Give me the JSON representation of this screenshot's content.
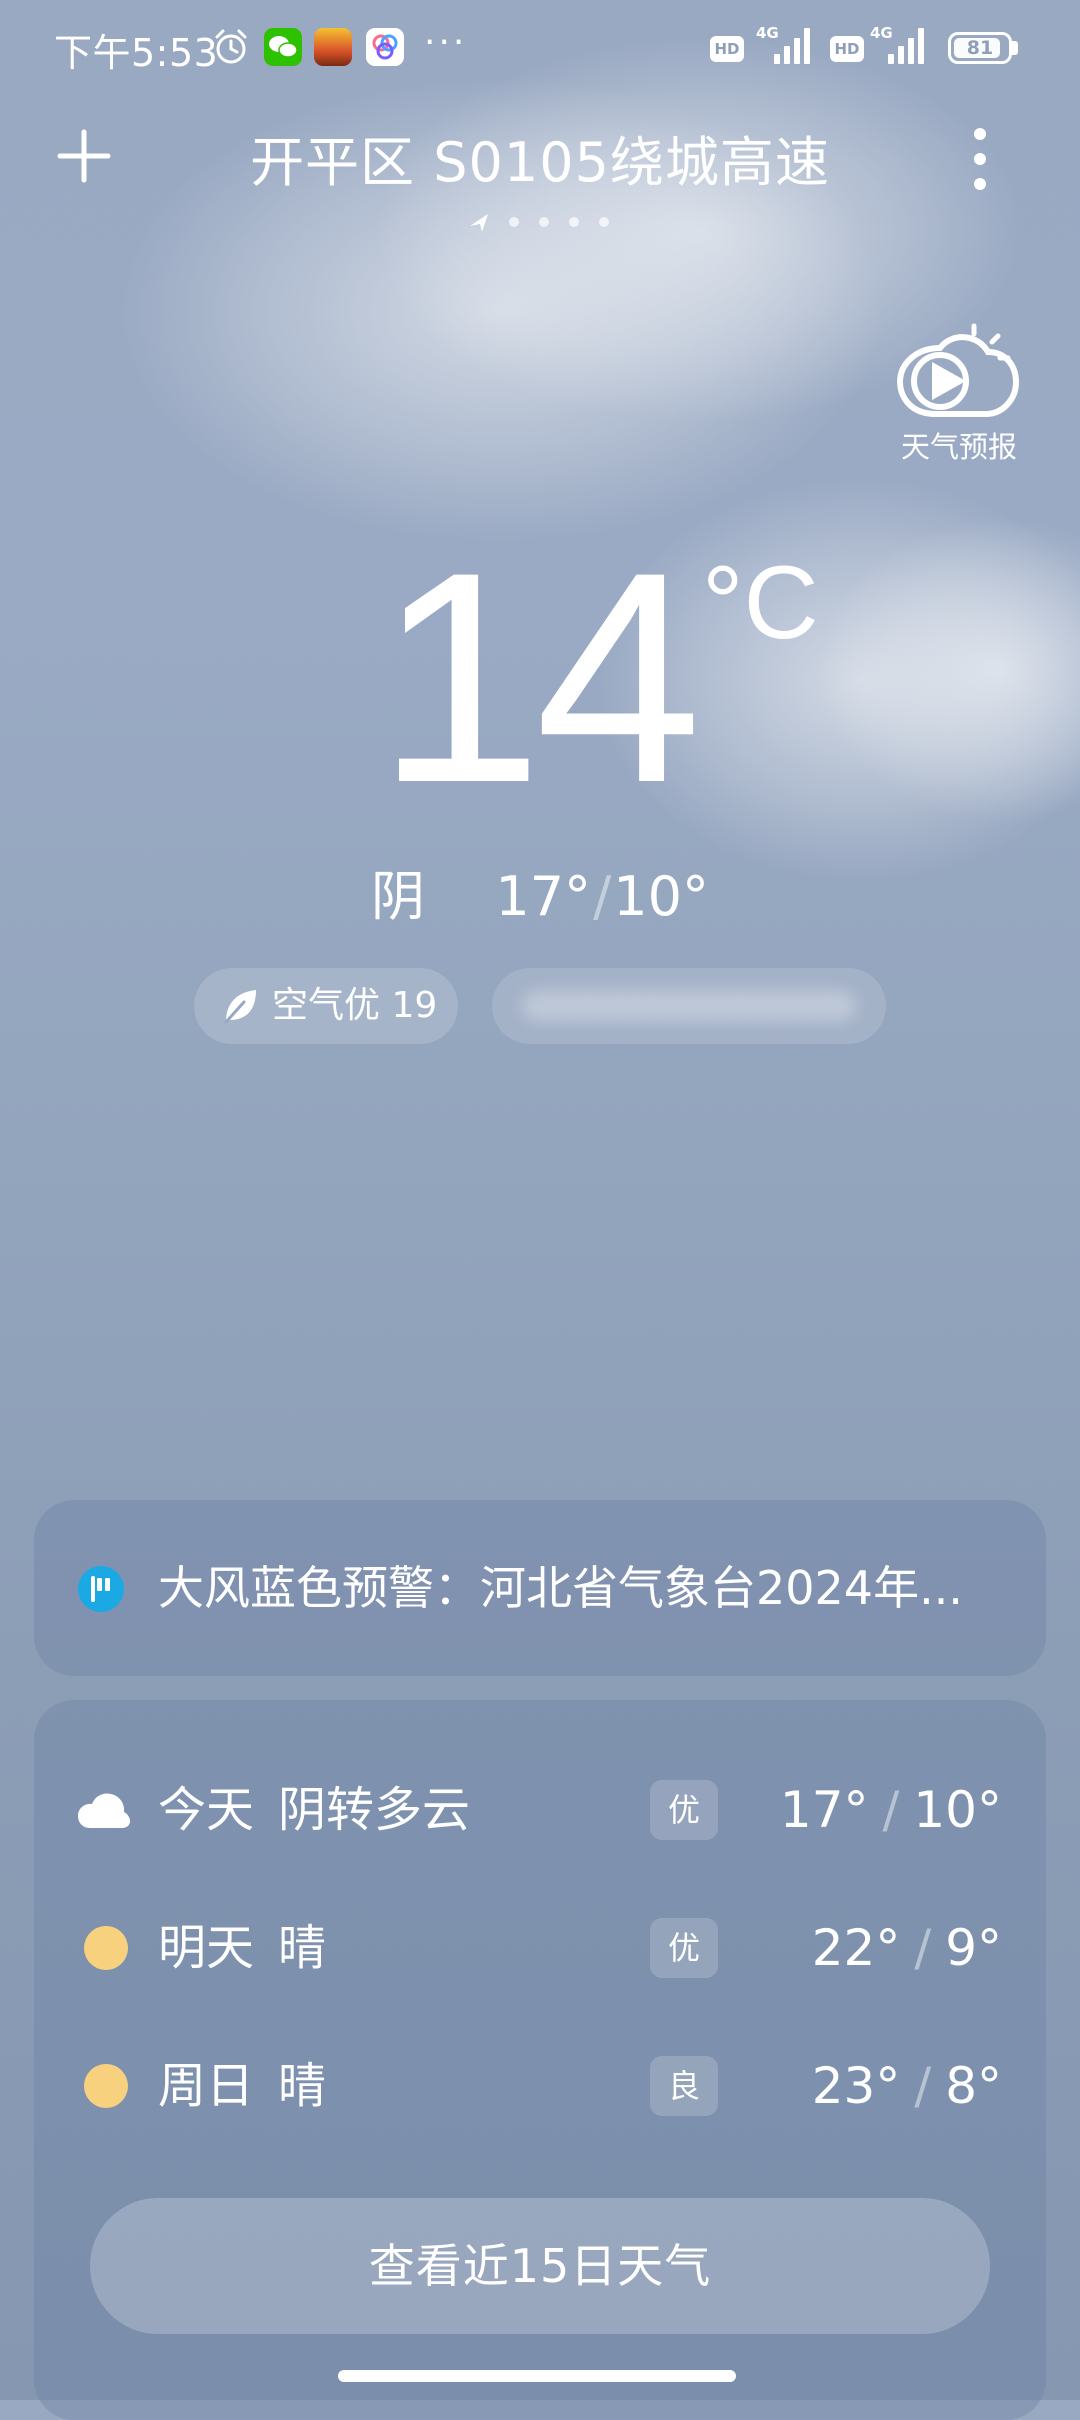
{
  "status_bar": {
    "time": "下午5:53",
    "more": "···",
    "hd_label": "HD",
    "network_label": "4G",
    "battery_level": "81"
  },
  "header": {
    "location": "开平区 S0105绕城高速",
    "page_count": 5,
    "active_page": 0
  },
  "forecast_video": {
    "label": "天气预报",
    "icon": "play-cloud-icon"
  },
  "current": {
    "temperature": "14",
    "unit": "°C",
    "condition": "阴",
    "high": "17°",
    "low": "10°",
    "separator": "/"
  },
  "air_quality": {
    "label": "空气优 19",
    "icon": "leaf-icon"
  },
  "alert": {
    "text": "大风蓝色预警：河北省气象台2024年...",
    "icon": "flag-icon",
    "accent_color": "#1ba9e6"
  },
  "daily_forecast": {
    "rows": [
      {
        "day": "今天",
        "condition": "阴转多云",
        "aqi": "优",
        "high": "17°",
        "low": "10°",
        "icon": "cloud-icon"
      },
      {
        "day": "明天",
        "condition": "晴",
        "aqi": "优",
        "high": "22°",
        "low": "9°",
        "icon": "sun-icon"
      },
      {
        "day": "周日",
        "condition": "晴",
        "aqi": "良",
        "high": "23°",
        "low": "8°",
        "icon": "sun-icon"
      }
    ],
    "separator": "/",
    "view_more_label": "查看近15日天气"
  },
  "colors": {
    "sun": "#f7d17e",
    "background": "#94a5be"
  }
}
